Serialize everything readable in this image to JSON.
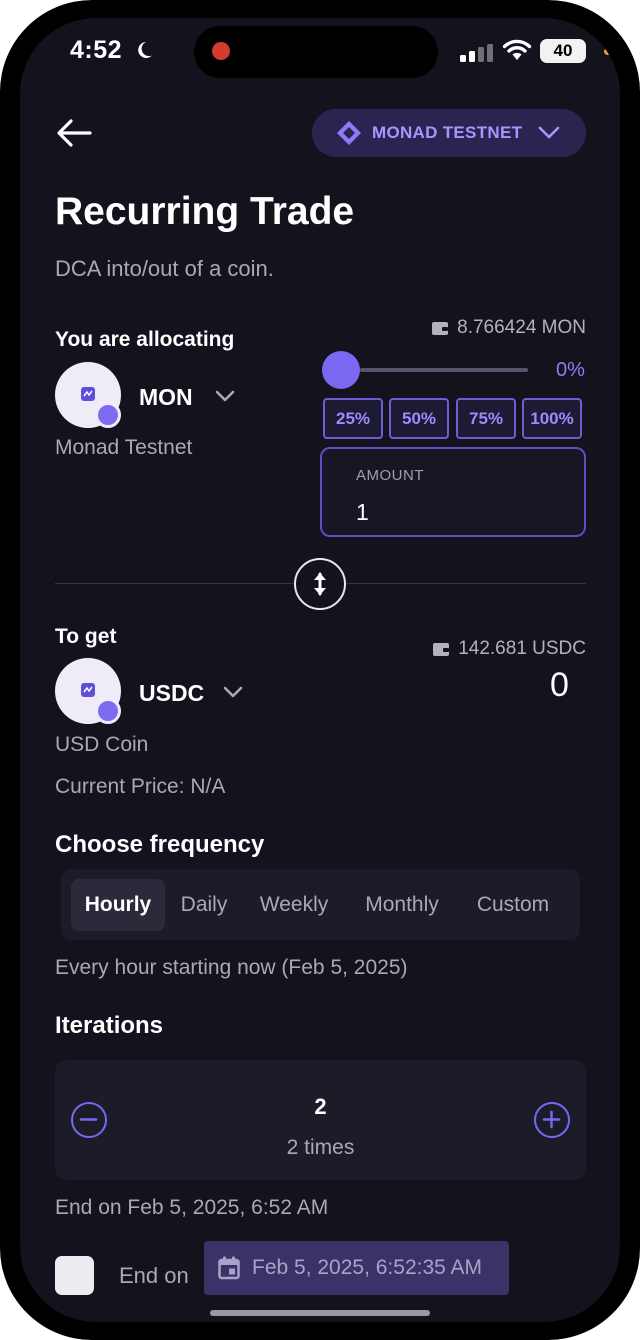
{
  "status_bar": {
    "time": "4:52",
    "battery": "40"
  },
  "header": {
    "network_label": "MONAD TESTNET"
  },
  "page": {
    "title": "Recurring Trade",
    "subtitle": "DCA into/out of a coin."
  },
  "allocate": {
    "label": "You are allocating",
    "coin_symbol": "MON",
    "coin_name": "Monad Testnet",
    "balance": "8.766424 MON",
    "slider_percent_text": "0%",
    "slider_value": 0,
    "percent_buttons": [
      "25%",
      "50%",
      "75%",
      "100%"
    ],
    "amount_label": "AMOUNT",
    "amount_value": "1"
  },
  "receive": {
    "label": "To get",
    "coin_symbol": "USDC",
    "coin_name": "USD Coin",
    "balance": "142.681 USDC",
    "output_value": "0",
    "current_price": "Current Price: N/A"
  },
  "frequency": {
    "label": "Choose frequency",
    "options": [
      "Hourly",
      "Daily",
      "Weekly",
      "Monthly",
      "Custom"
    ],
    "selected": "Hourly",
    "description": "Every hour starting now (Feb 5, 2025)"
  },
  "iterations": {
    "label": "Iterations",
    "value": "2",
    "times_text": "2 times",
    "end_text": "End on Feb 5, 2025, 6:52 AM"
  },
  "end_on": {
    "label": "End on",
    "date_value": "Feb 5, 2025, 6:52:35 AM"
  },
  "colors": {
    "background": "#13121d",
    "accent": "#7a67f2",
    "panel": "#1c1c29"
  }
}
